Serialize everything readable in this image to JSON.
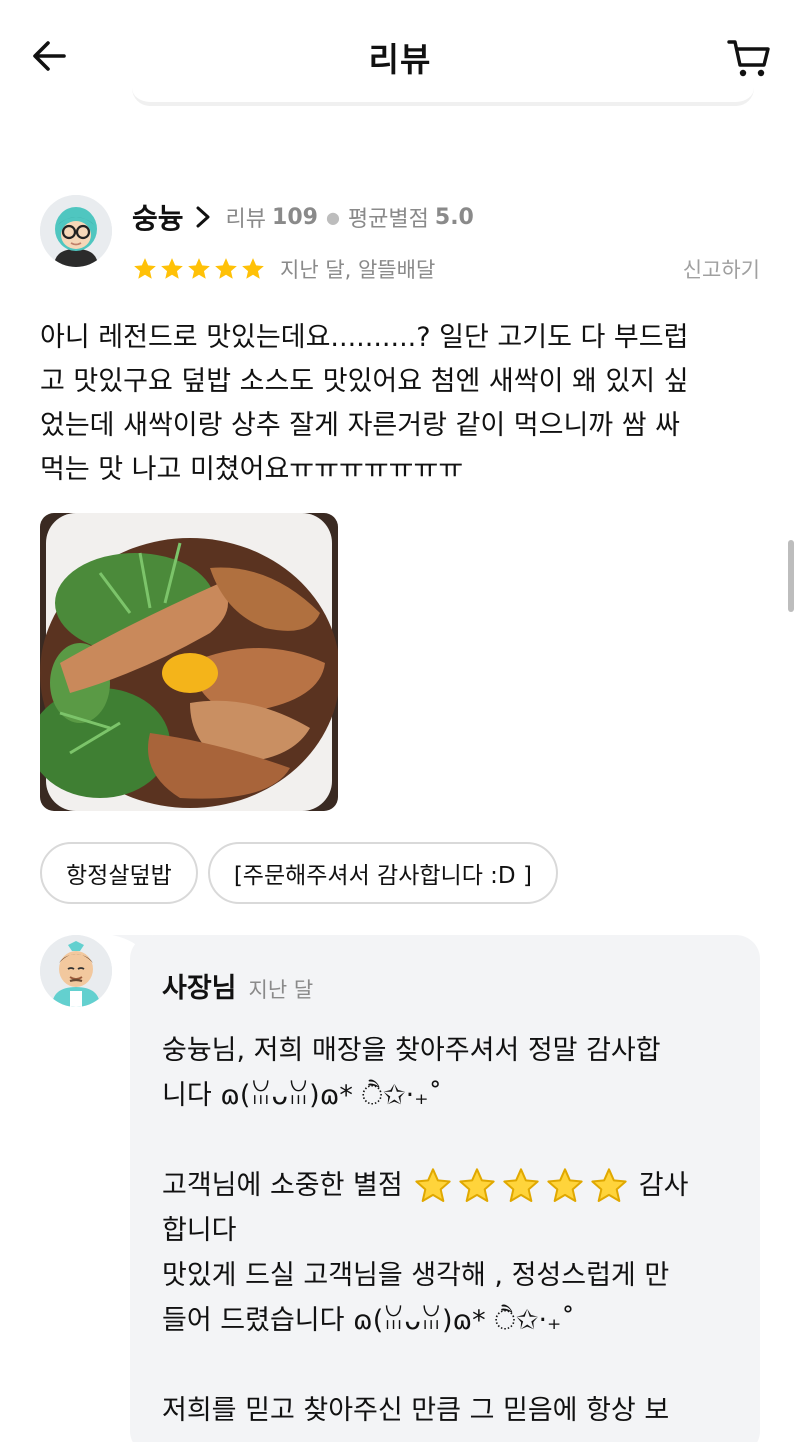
{
  "header": {
    "title": "리뷰",
    "back_icon": "arrow-left-icon",
    "cart_icon": "cart-icon"
  },
  "review": {
    "username": "숭늉",
    "review_count_label": "리뷰",
    "review_count": "109",
    "avg_rating_label": "평균별점",
    "avg_rating": "5.0",
    "stars": 5,
    "meta": "지난 달, 알뜰배달",
    "report_label": "신고하기",
    "text_lines": [
      "아니 레전드로 맛있는데요..........? 일단 고기도 다 부드럽",
      "고 맛있구요 덮밥 소스도 맛있어요 첨엔 새싹이 왜 있지 싶",
      "었는데 새싹이랑 상추 잘게 자른거랑 같이 먹으니까 쌈 싸",
      "먹는 맛 나고 미쳤어요ㅠㅠㅠㅠㅠㅠㅠ"
    ],
    "photo": "food-photo-image",
    "tags": [
      "항정살덮밥",
      "[주문해주셔서 감사합니다 :D ]"
    ]
  },
  "owner_reply": {
    "name": "사장님",
    "time": "지난 달",
    "line1": "숭늉님, 저희 매장을 찾아주셔서 정말 감사합",
    "line2": "니다 ɷ(ꈍᴗꈍ)ɷ* ੈ✩‧₊˚",
    "line3_before": "고객님에 소중한 별점",
    "line3_stars": 5,
    "line3_after": "감사",
    "line4": "합니다",
    "line5": "맛있게 드실 고객님을 생각해 , 정성스럽게 만",
    "line6": "들어 드렸습니다 ɷ(ꈍᴗꈍ)ɷ* ੈ✩‧₊˚",
    "line7": "저희를 믿고 찾아주신 만큼 그 믿음에 항상 보"
  },
  "colors": {
    "star": "#FFC107",
    "muted": "#8a8a8a",
    "bubble": "#f3f4f6",
    "chip_border": "#d9d9d9"
  }
}
